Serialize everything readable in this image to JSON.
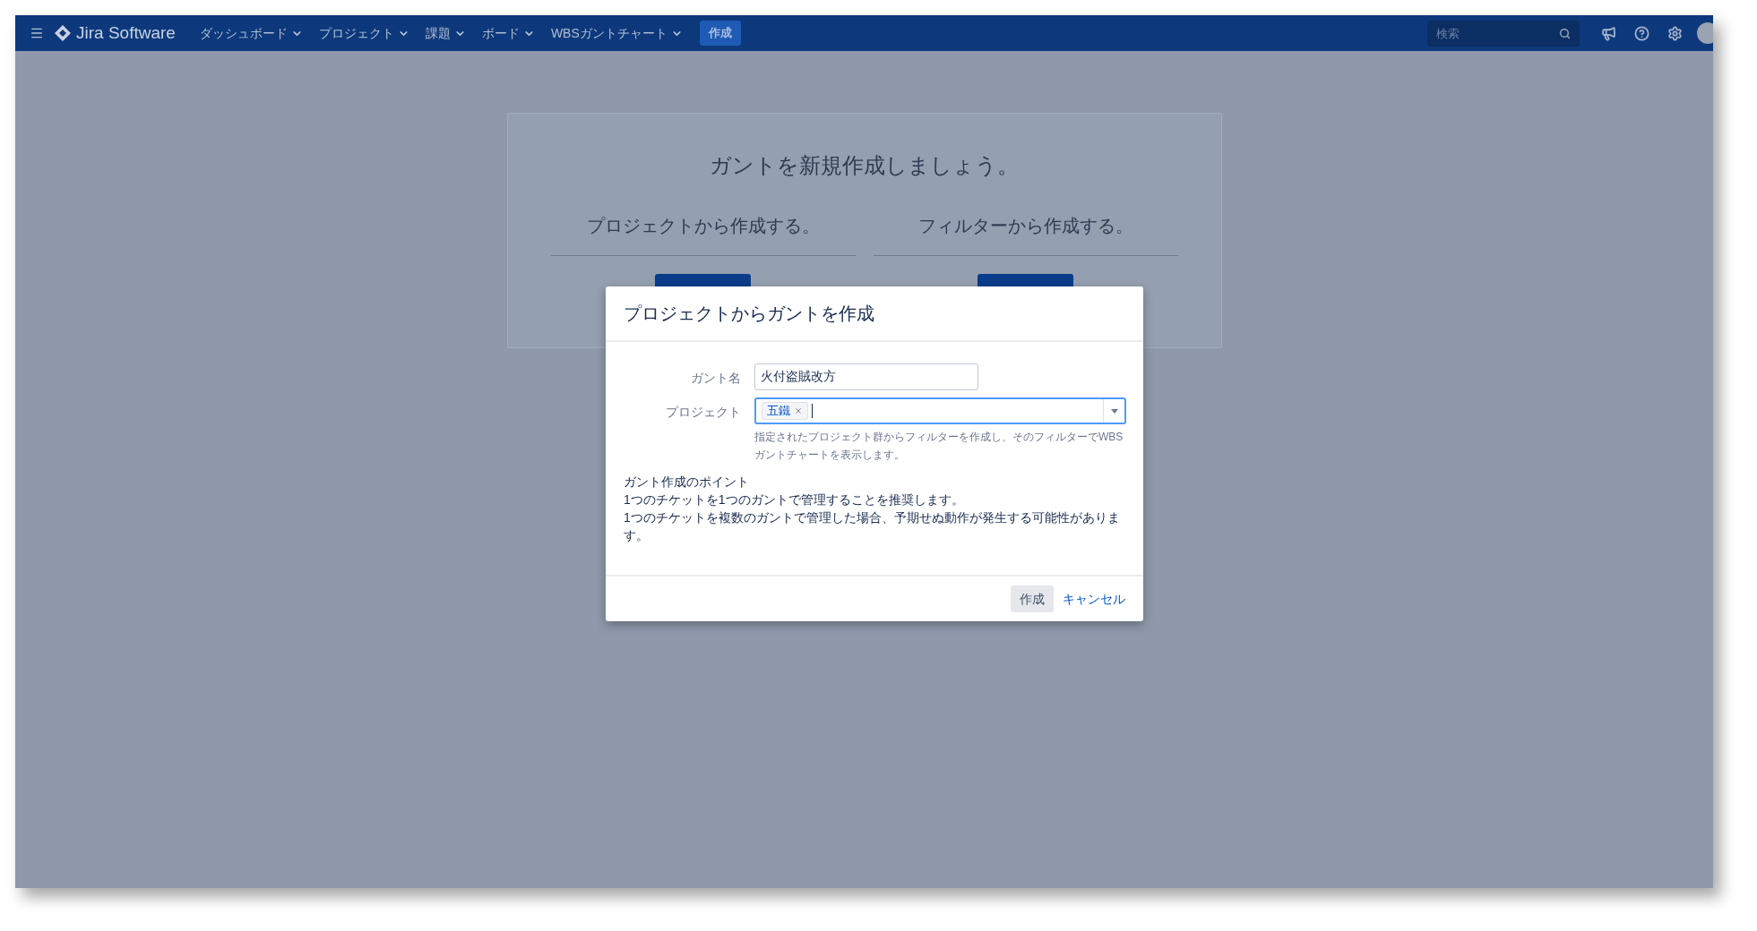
{
  "nav": {
    "menu_items": [
      {
        "label": "ダッシュボード"
      },
      {
        "label": "プロジェクト"
      },
      {
        "label": "課題"
      },
      {
        "label": "ボード"
      },
      {
        "label": "WBSガントチャート"
      }
    ],
    "product": "Jira Software",
    "create_button": "作成",
    "search": {
      "placeholder": "検索"
    }
  },
  "background": {
    "title": "ガントを新規作成しましょう。",
    "sections": [
      {
        "heading": "プロジェクトから作成する。"
      },
      {
        "heading": "フィルターから作成する。"
      }
    ]
  },
  "dialog": {
    "title": "プロジェクトからガントを作成",
    "fields": [
      {
        "kind": "text",
        "label": "ガント名",
        "value": "火付盗賊改方"
      },
      {
        "kind": "tags",
        "label": "プロジェクト",
        "tags": [
          "五鐵"
        ],
        "help": "指定されたプロジェクト群からフィルターを作成し、そのフィルターでWBSガントチャートを表示します。"
      }
    ],
    "notes": [
      "ガント作成のポイント",
      "1つのチケットを1つのガントで管理することを推奨します。",
      "1つのチケットを複数のガントで管理した場合、予期せぬ動作が発生する可能性があります。"
    ],
    "buttons": [
      {
        "kind": "primary",
        "label": "作成"
      },
      {
        "kind": "link",
        "label": "キャンセル"
      }
    ]
  }
}
